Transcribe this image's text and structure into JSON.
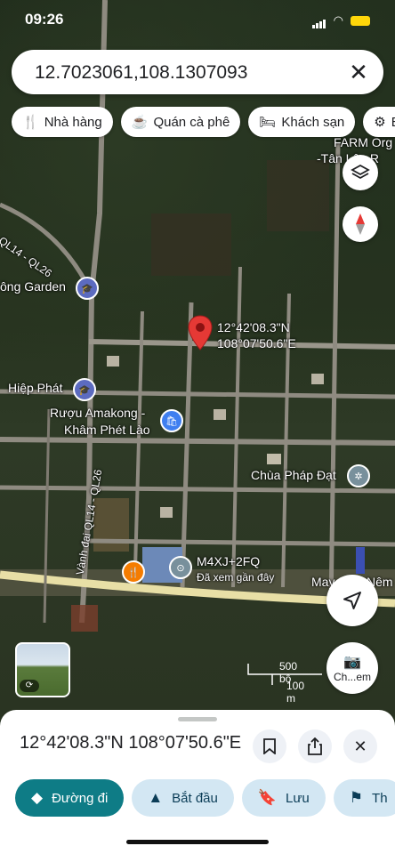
{
  "status_bar": {
    "time": "09:26"
  },
  "search": {
    "value": "12.7023061,108.1307093"
  },
  "chips": [
    {
      "icon": "restaurant-icon",
      "label": "Nhà hàng"
    },
    {
      "icon": "coffee-icon",
      "label": "Quán cà phê"
    },
    {
      "icon": "hotel-icon",
      "label": "Khách sạn"
    },
    {
      "icon": "more-category-icon",
      "label": "B"
    }
  ],
  "map": {
    "pin_lat": "12°42'08.3\"N",
    "pin_lng": "108°07'50.6\"E",
    "labels": {
      "farm_line1": "FARM Org",
      "farm_line2": "-Tân Lập R",
      "road_top": "QL14 - QL26",
      "garden": "ông Garden",
      "hiep_phat": "Hiệp Phát",
      "ruou_line1": "Rượu Amakong -",
      "ruou_line2": "Khâm Phét Lào",
      "chua": "Chùa Pháp Đạt",
      "road_side": "Vành đai QL14 - QL26",
      "pluscode": "M4XJ+2FQ",
      "recent": "Đã xem gần đây",
      "may": "May",
      "nem": "Nêm"
    },
    "scale": {
      "ft": "500 bộ",
      "m": "100 m"
    },
    "streetview_label": "Ch...em"
  },
  "sheet": {
    "title": "12°42'08.3\"N 108°07'50.6\"E",
    "actions": [
      {
        "icon": "directions-icon",
        "label": "Đường đi"
      },
      {
        "icon": "navigation-icon",
        "label": "Bắt đầu"
      },
      {
        "icon": "bookmark-icon",
        "label": "Lưu"
      },
      {
        "icon": "flag-icon",
        "label": "Th"
      }
    ]
  },
  "colors": {
    "accent": "#0e7c86",
    "pin": "#e53935",
    "chip_bg": "#ffffff",
    "action_bg": "#d3e7f3"
  }
}
